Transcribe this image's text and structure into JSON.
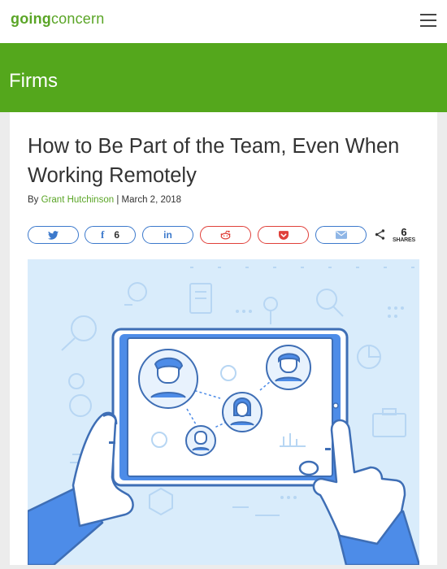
{
  "header": {
    "logo_bold": "going",
    "logo_regular": "concern",
    "menu_icon": "hamburger-icon"
  },
  "category": "Firms",
  "article": {
    "title": "How to Be Part of the Team, Even When Working Remotely",
    "by_prefix": "By",
    "author": "Grant Hutchinson",
    "separator": "|",
    "date": "March 2, 2018"
  },
  "share": {
    "buttons": [
      {
        "network": "twitter",
        "icon": "twitter-bird-icon",
        "color": "#3c79cc"
      },
      {
        "network": "facebook",
        "icon": "facebook-f-icon",
        "glyph": "f",
        "count": "6",
        "color": "#3c79cc"
      },
      {
        "network": "linkedin",
        "icon": "linkedin-in-icon",
        "glyph": "in",
        "color": "#3c79cc"
      },
      {
        "network": "reddit",
        "icon": "reddit-alien-icon",
        "color": "#e0403a"
      },
      {
        "network": "pocket",
        "icon": "pocket-icon",
        "color": "#e0403a"
      },
      {
        "network": "email",
        "icon": "envelope-icon",
        "color": "#3c79cc"
      }
    ],
    "total": "6",
    "total_label": "SHARES",
    "share_icon": "share-icon"
  },
  "colors": {
    "brand_green": "#54a71c",
    "link_green": "#5aa526",
    "illustration_bg": "#d9ecfb"
  }
}
